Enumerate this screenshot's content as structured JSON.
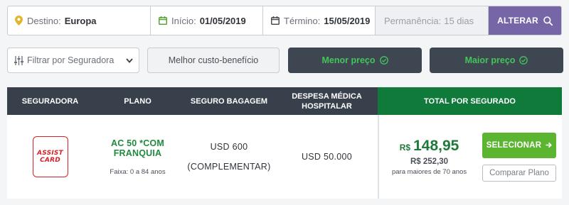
{
  "search": {
    "destino_label": "Destino:",
    "destino_value": "Europa",
    "inicio_label": "Início:",
    "inicio_value": "01/05/2019",
    "termino_label": "Término:",
    "termino_value": "15/05/2019",
    "permanencia_label": "Permanência:",
    "permanencia_value": "15 dias",
    "alterar_label": "ALTERAR"
  },
  "filters": {
    "seguradora_placeholder": "Filtrar por Seguradora",
    "melhor_label": "Melhor custo-benefício",
    "menor_label": "Menor preço",
    "maior_label": "Maior preço"
  },
  "table": {
    "headers": {
      "seguradora": "SEGURADORA",
      "plano": "PLANO",
      "bagagem": "SEGURO BAGAGEM",
      "despesa_line1": "DESPESA MÉDICA",
      "despesa_line2": "HOSPITALAR",
      "total": "TOTAL POR SEGURADO"
    },
    "rows": [
      {
        "logo_line1": "ASSIST",
        "logo_line2": "CARD",
        "plano": "AC 50 *COM FRANQUIA",
        "faixa": "Faixa: 0 a 84 anos",
        "bagagem_line1": "USD 600",
        "bagagem_line2": "(COMPLEMENTAR)",
        "despesa": "USD 50.000",
        "price_currency": "R$",
        "price_value": "148,95",
        "price_secondary": "R$ 252,30",
        "price_note": "para maiores de 70 anos",
        "select_label": "SELECIONAR",
        "compare_label": "Comparar Plano"
      }
    ]
  },
  "colors": {
    "accent_purple": "#7666a7",
    "dark_header": "#37404b",
    "total_green": "#0f7a3a",
    "select_green": "#5cb531",
    "check_green": "#43c65a",
    "brand_red": "#d82028"
  },
  "icons": {
    "destino": "map-pin-icon",
    "inicio": "calendar-icon",
    "termino": "calendar-icon",
    "alterar": "search-icon",
    "filter": "sliders-icon",
    "dropdown": "chevron-down-icon",
    "check": "check-circle-icon",
    "arrow": "arrow-right-icon"
  }
}
